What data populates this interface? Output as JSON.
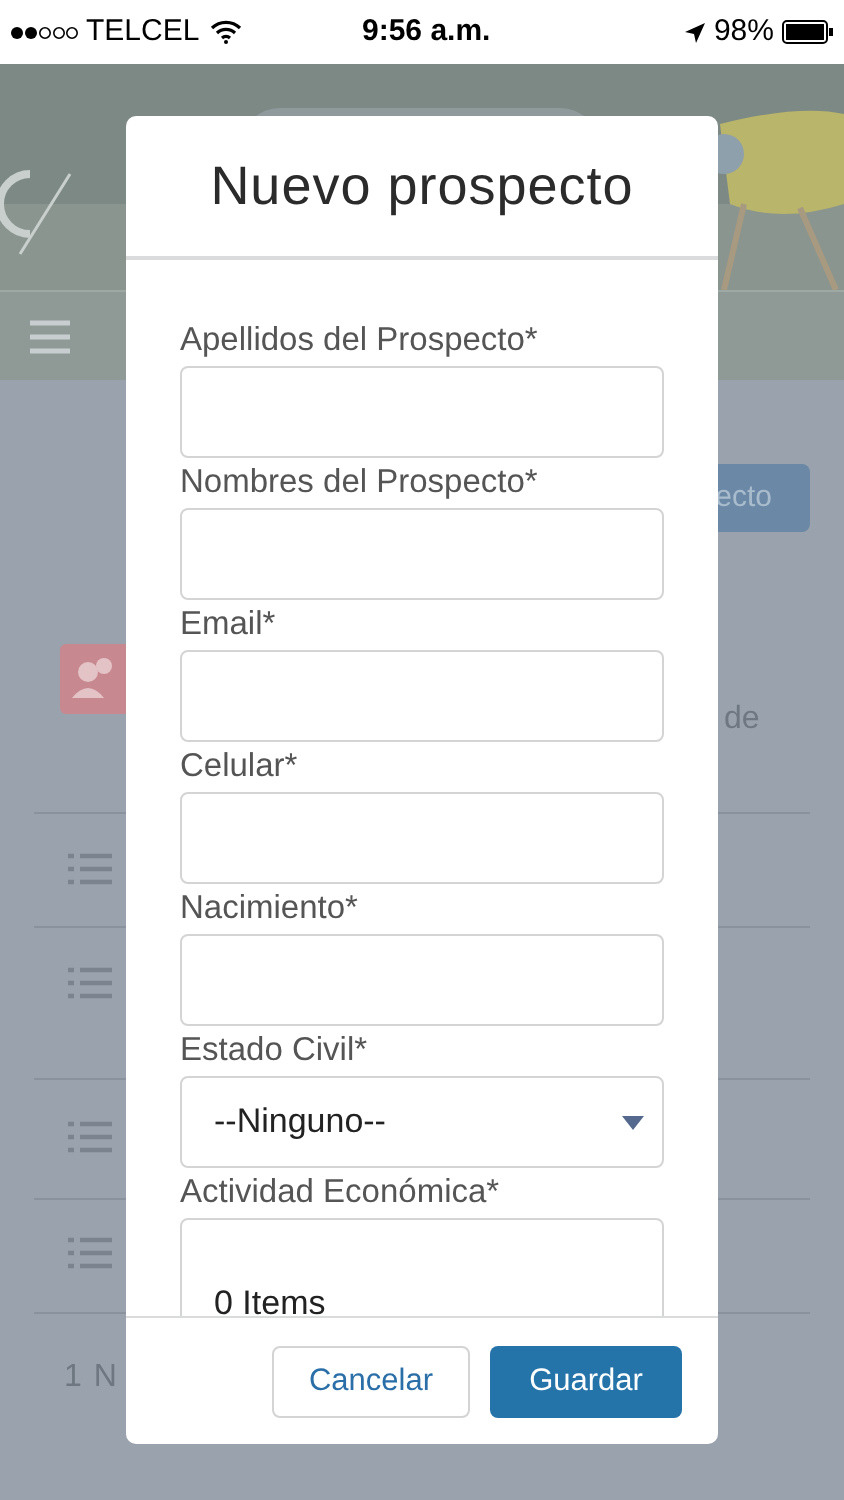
{
  "status_bar": {
    "carrier": "TELCEL",
    "time": "9:56 a.m.",
    "battery": "98%"
  },
  "background": {
    "button_text": "ecto",
    "text": "de",
    "pager": [
      "1",
      "N"
    ]
  },
  "modal": {
    "title": "Nuevo prospecto",
    "fields": [
      {
        "label": "Apellidos del Prospecto*",
        "kind": "text"
      },
      {
        "label": "Nombres del Prospecto*",
        "kind": "text"
      },
      {
        "label": "Email*",
        "kind": "text"
      },
      {
        "label": "Celular*",
        "kind": "text"
      },
      {
        "label": "Nacimiento*",
        "kind": "text"
      },
      {
        "label": "Estado Civil*",
        "kind": "select",
        "value": "--Ninguno--"
      },
      {
        "label": "Actividad Económica*",
        "kind": "multi",
        "value": "0 Items"
      }
    ],
    "buttons": [
      {
        "label": "Cancelar",
        "kind": "secondary"
      },
      {
        "label": "Guardar",
        "kind": "primary"
      }
    ]
  }
}
